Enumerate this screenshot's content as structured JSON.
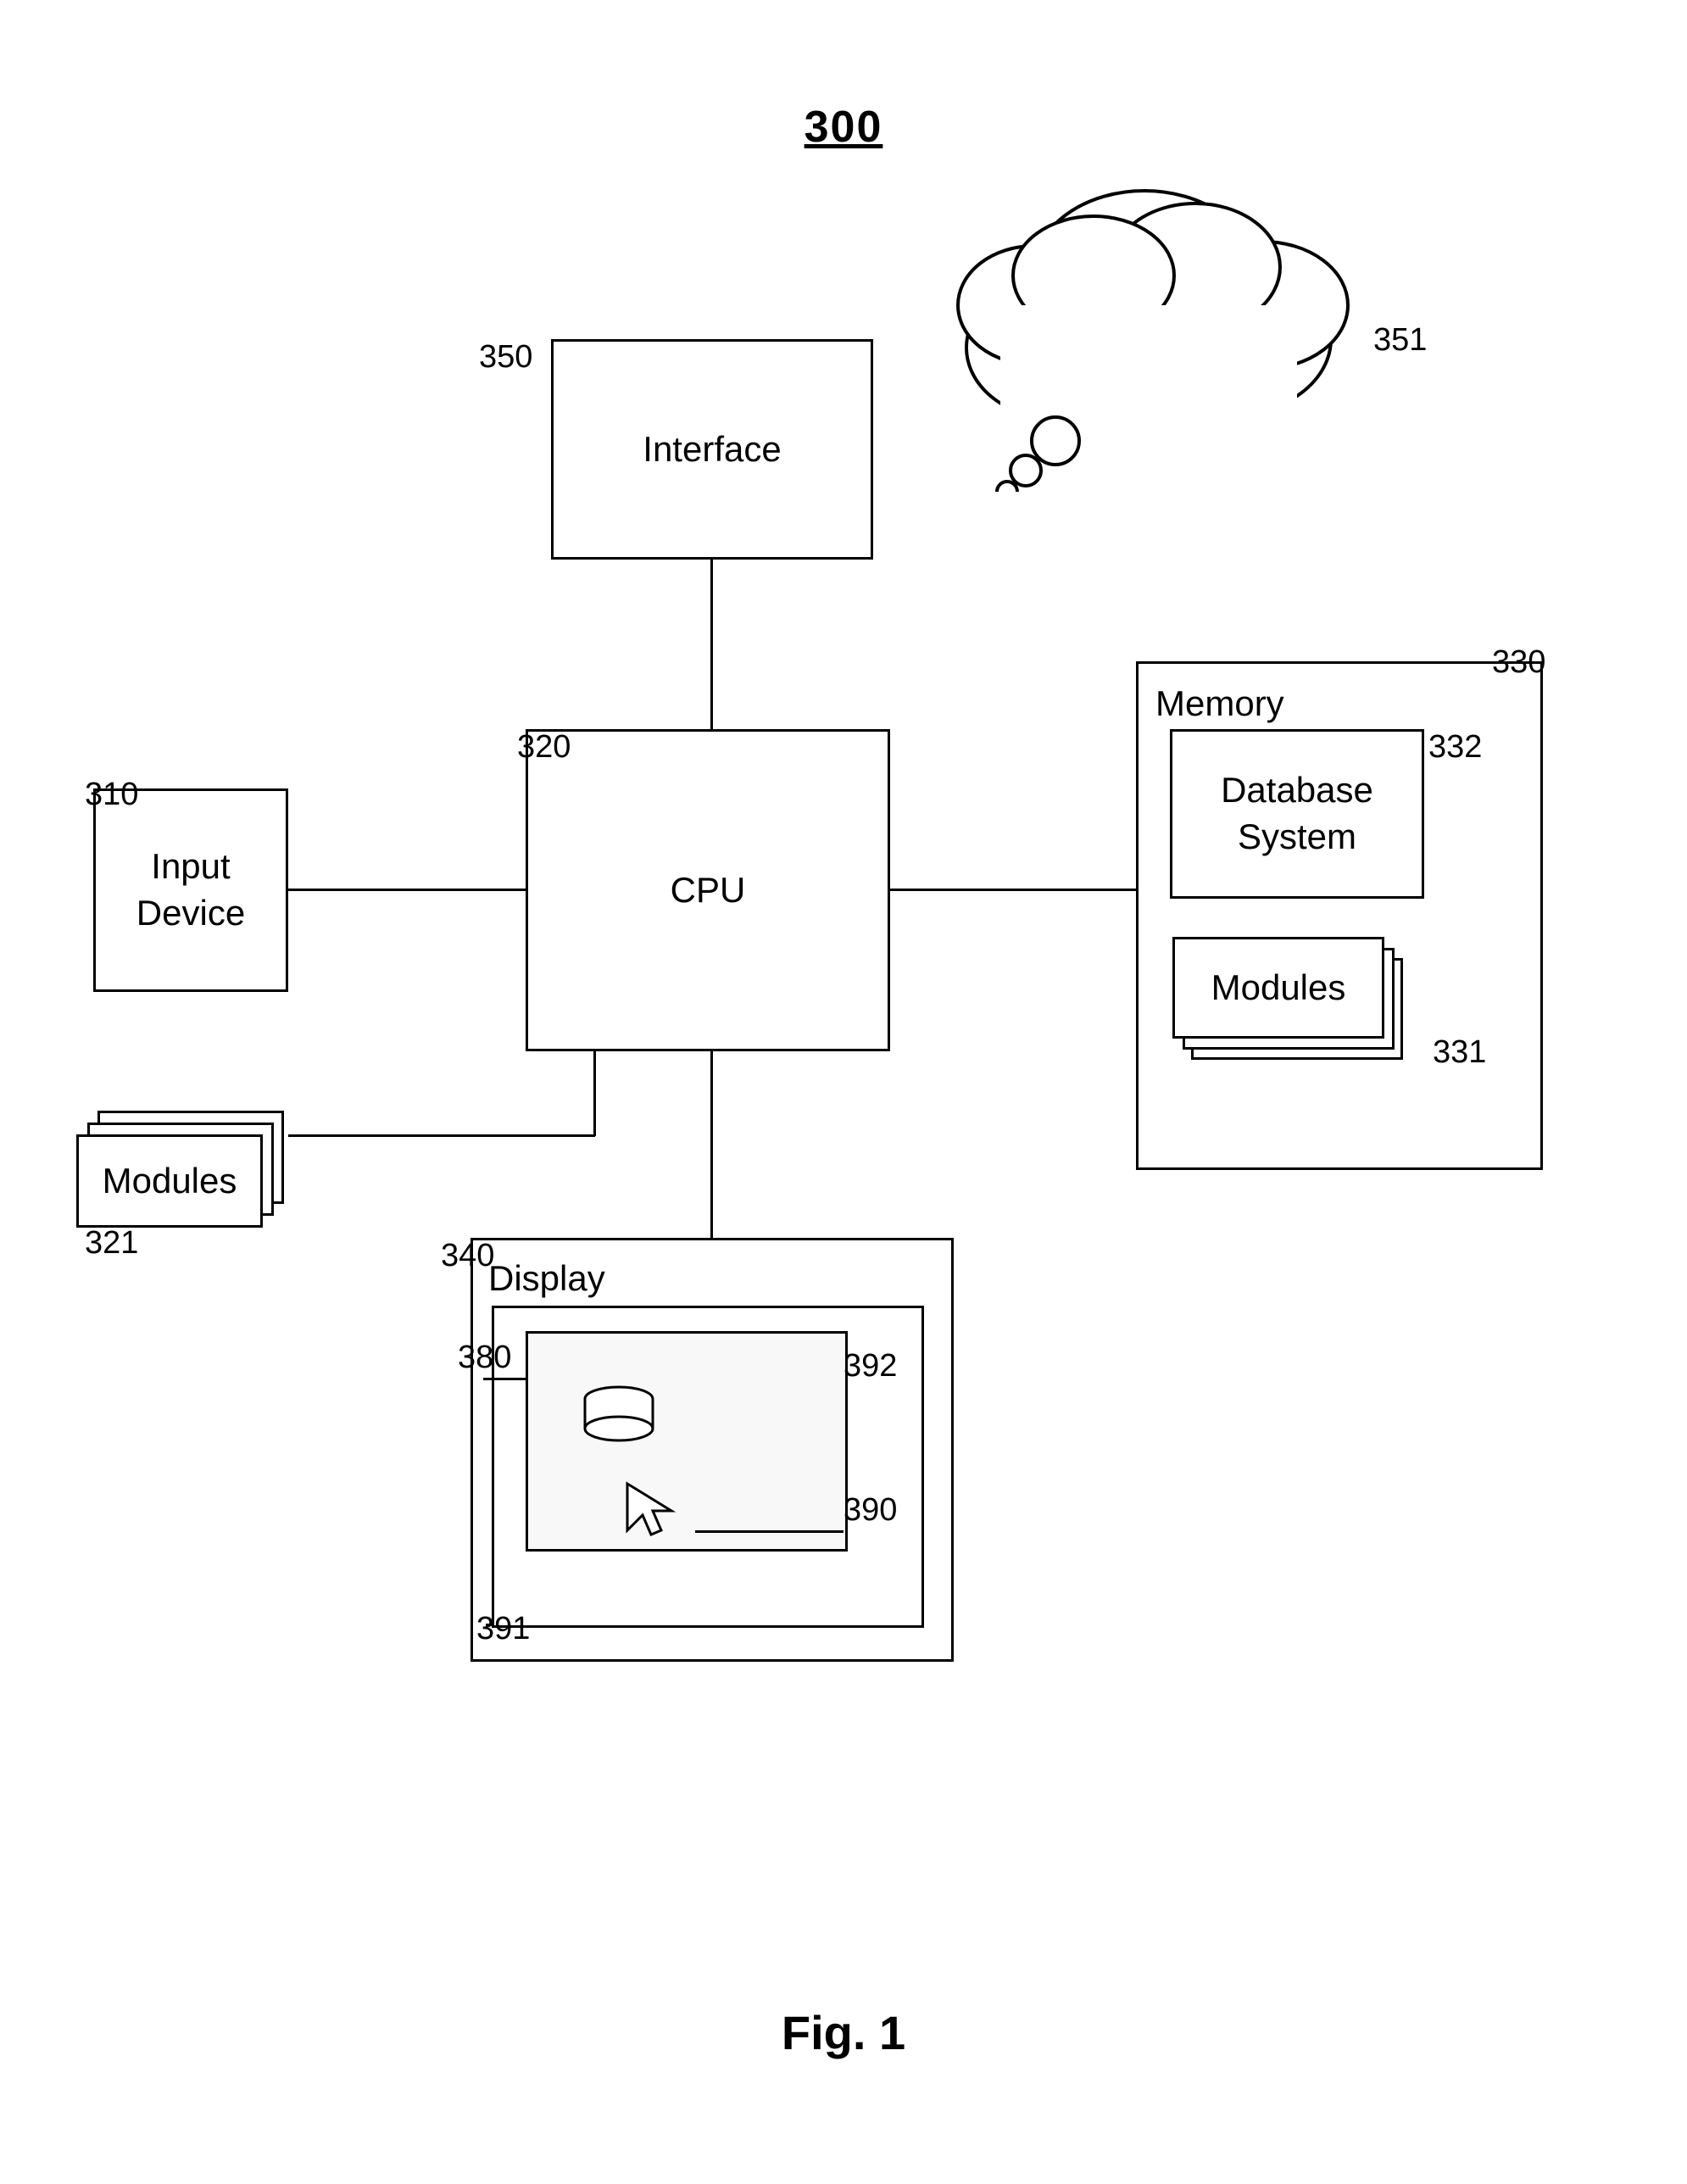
{
  "figure_number": "300",
  "figure_label": "Fig. 1",
  "nodes": {
    "interface": {
      "label": "Interface",
      "ref": "350"
    },
    "cpu": {
      "label": "CPU",
      "ref": "320"
    },
    "input_device": {
      "label": "Input\nDevice",
      "ref": "310"
    },
    "memory": {
      "label": "Memory",
      "ref": "330"
    },
    "database_system": {
      "label": "Database\nSystem",
      "ref": "332"
    },
    "modules_memory": {
      "label": "Modules",
      "ref": "331"
    },
    "modules_cpu": {
      "label": "Modules",
      "ref": "321"
    },
    "display": {
      "label": "Display",
      "ref": "340"
    },
    "cloud": {
      "ref": "351"
    },
    "screen_ref": "380",
    "cursor_area": "390",
    "screen_inner_ref": "392",
    "display_inner_ref": "391"
  }
}
